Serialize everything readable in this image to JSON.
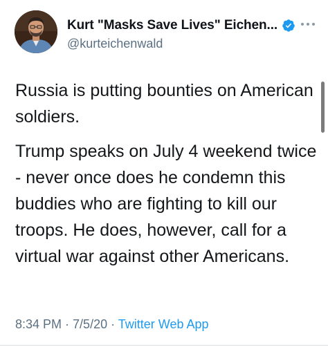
{
  "tweet": {
    "author": {
      "display_name": "Kurt \"Masks Save Lives\" Eichen...",
      "handle": "@kurteichenwald",
      "verified_icon": "verified-badge-icon",
      "avatar": "profile-photo"
    },
    "more_icon": "more-options-icon",
    "text": {
      "paragraph1": "Russia is putting bounties on American soldiers.",
      "paragraph2": "Trump speaks on July 4 weekend twice - never once does he condemn this buddies who are fighting to kill our troops. He does, however, call for a virtual war against other Americans."
    },
    "meta": {
      "time": "8:34 PM",
      "separator1": " · ",
      "date": "7/5/20",
      "separator2": " · ",
      "source": "Twitter Web App"
    }
  },
  "colors": {
    "verified": "#1d9bf0",
    "secondary_text": "#5b7083",
    "link": "#1d9bf0"
  }
}
